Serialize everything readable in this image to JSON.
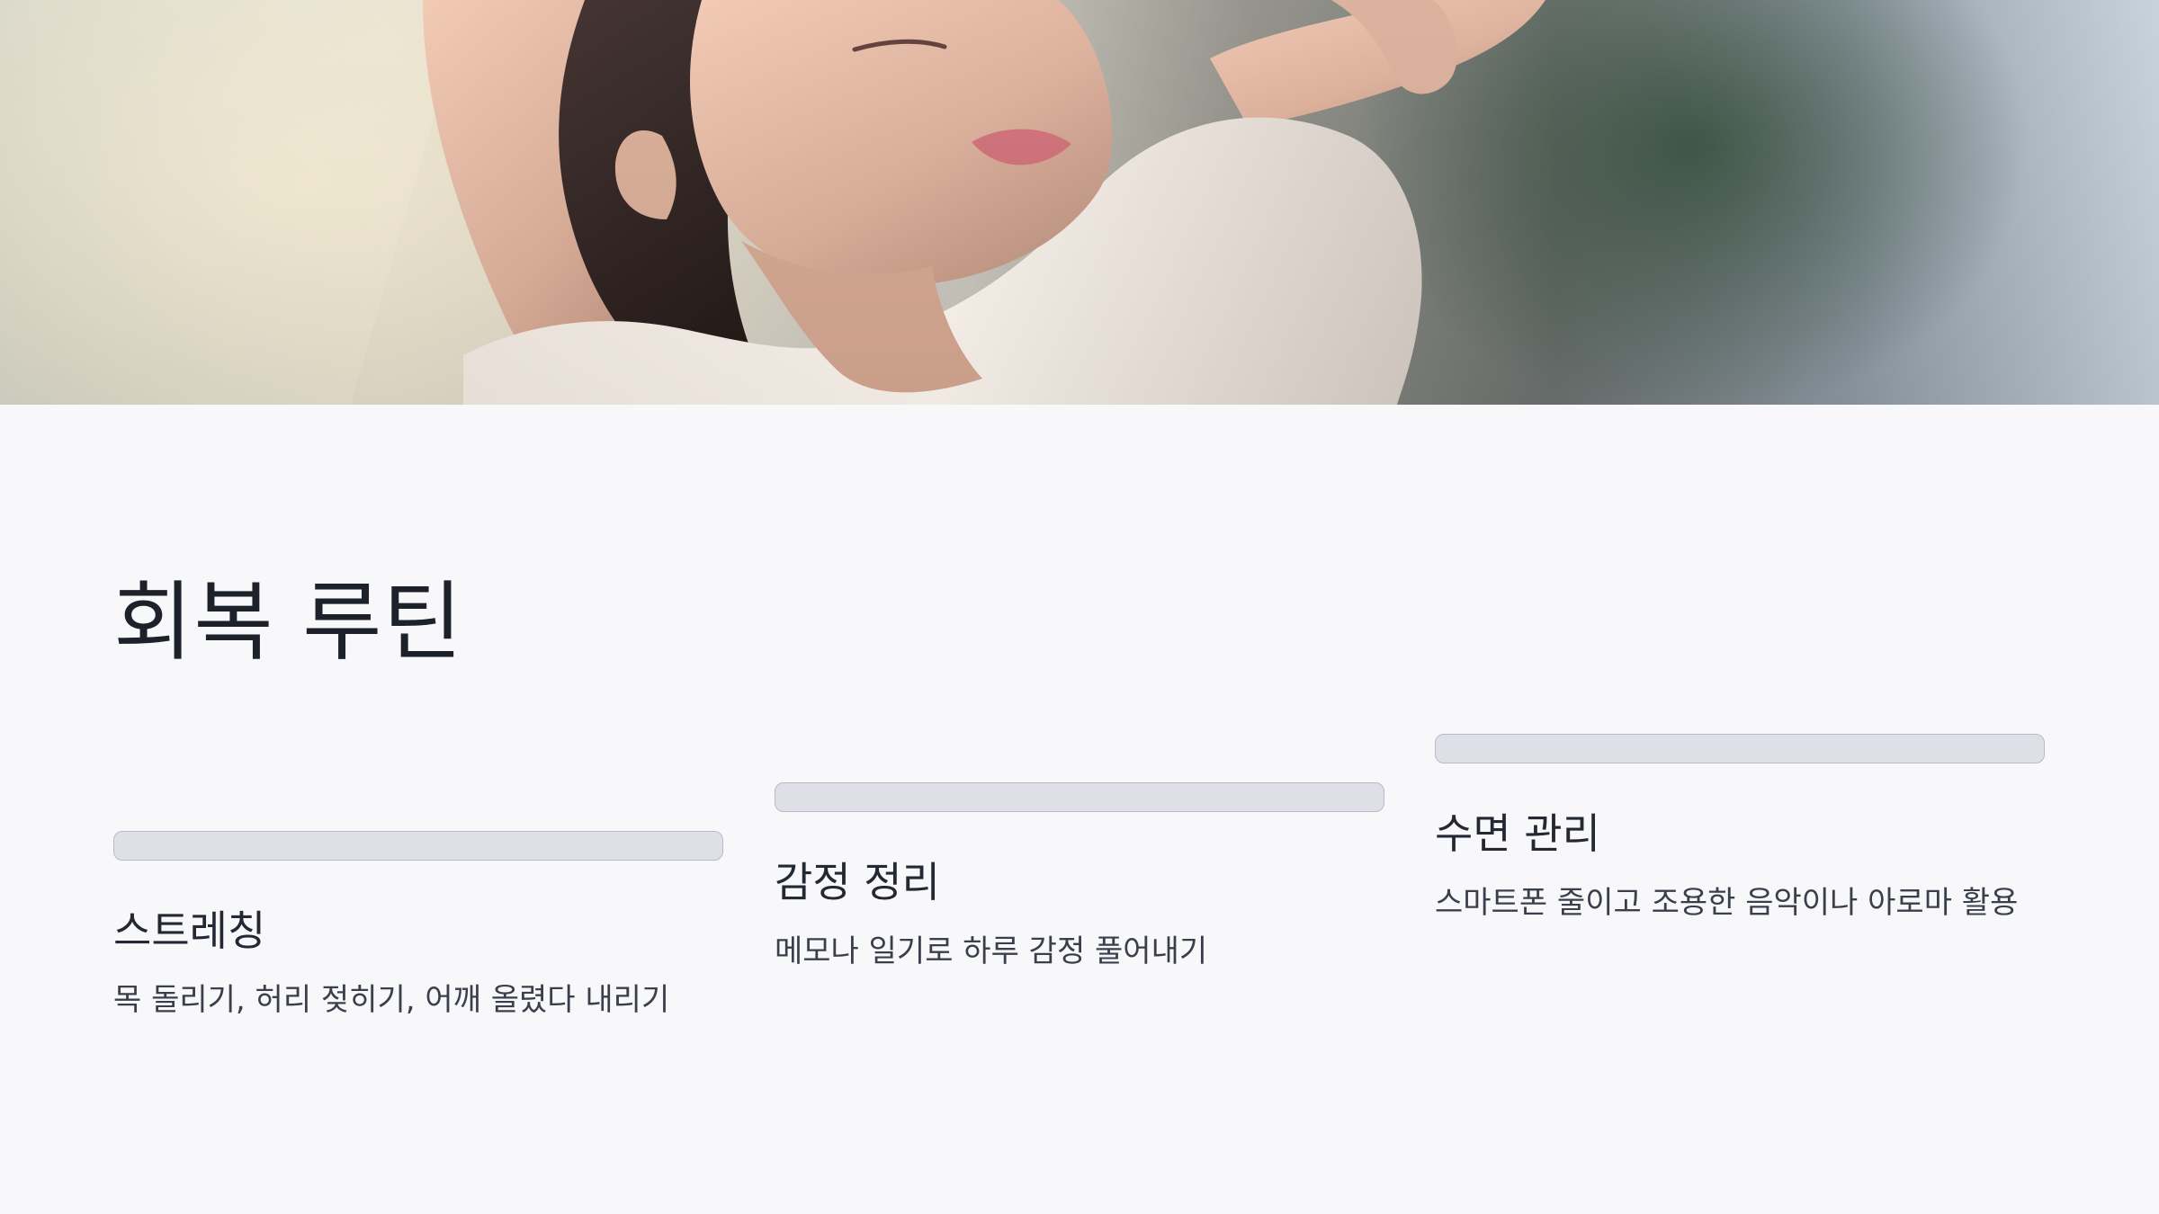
{
  "hero": {
    "image_alt": "smiling woman stretching with arms raised"
  },
  "slide": {
    "title": "회복 루틴"
  },
  "cards": [
    {
      "title": "스트레칭",
      "description": "목 돌리기, 허리 젖히기, 어깨 올렸다 내리기"
    },
    {
      "title": "감정 정리",
      "description": "메모나 일기로 하루 감정 풀어내기"
    },
    {
      "title": "수면 관리",
      "description": "스마트폰 줄이고 조용한 음악이나 아로마 활용"
    }
  ]
}
